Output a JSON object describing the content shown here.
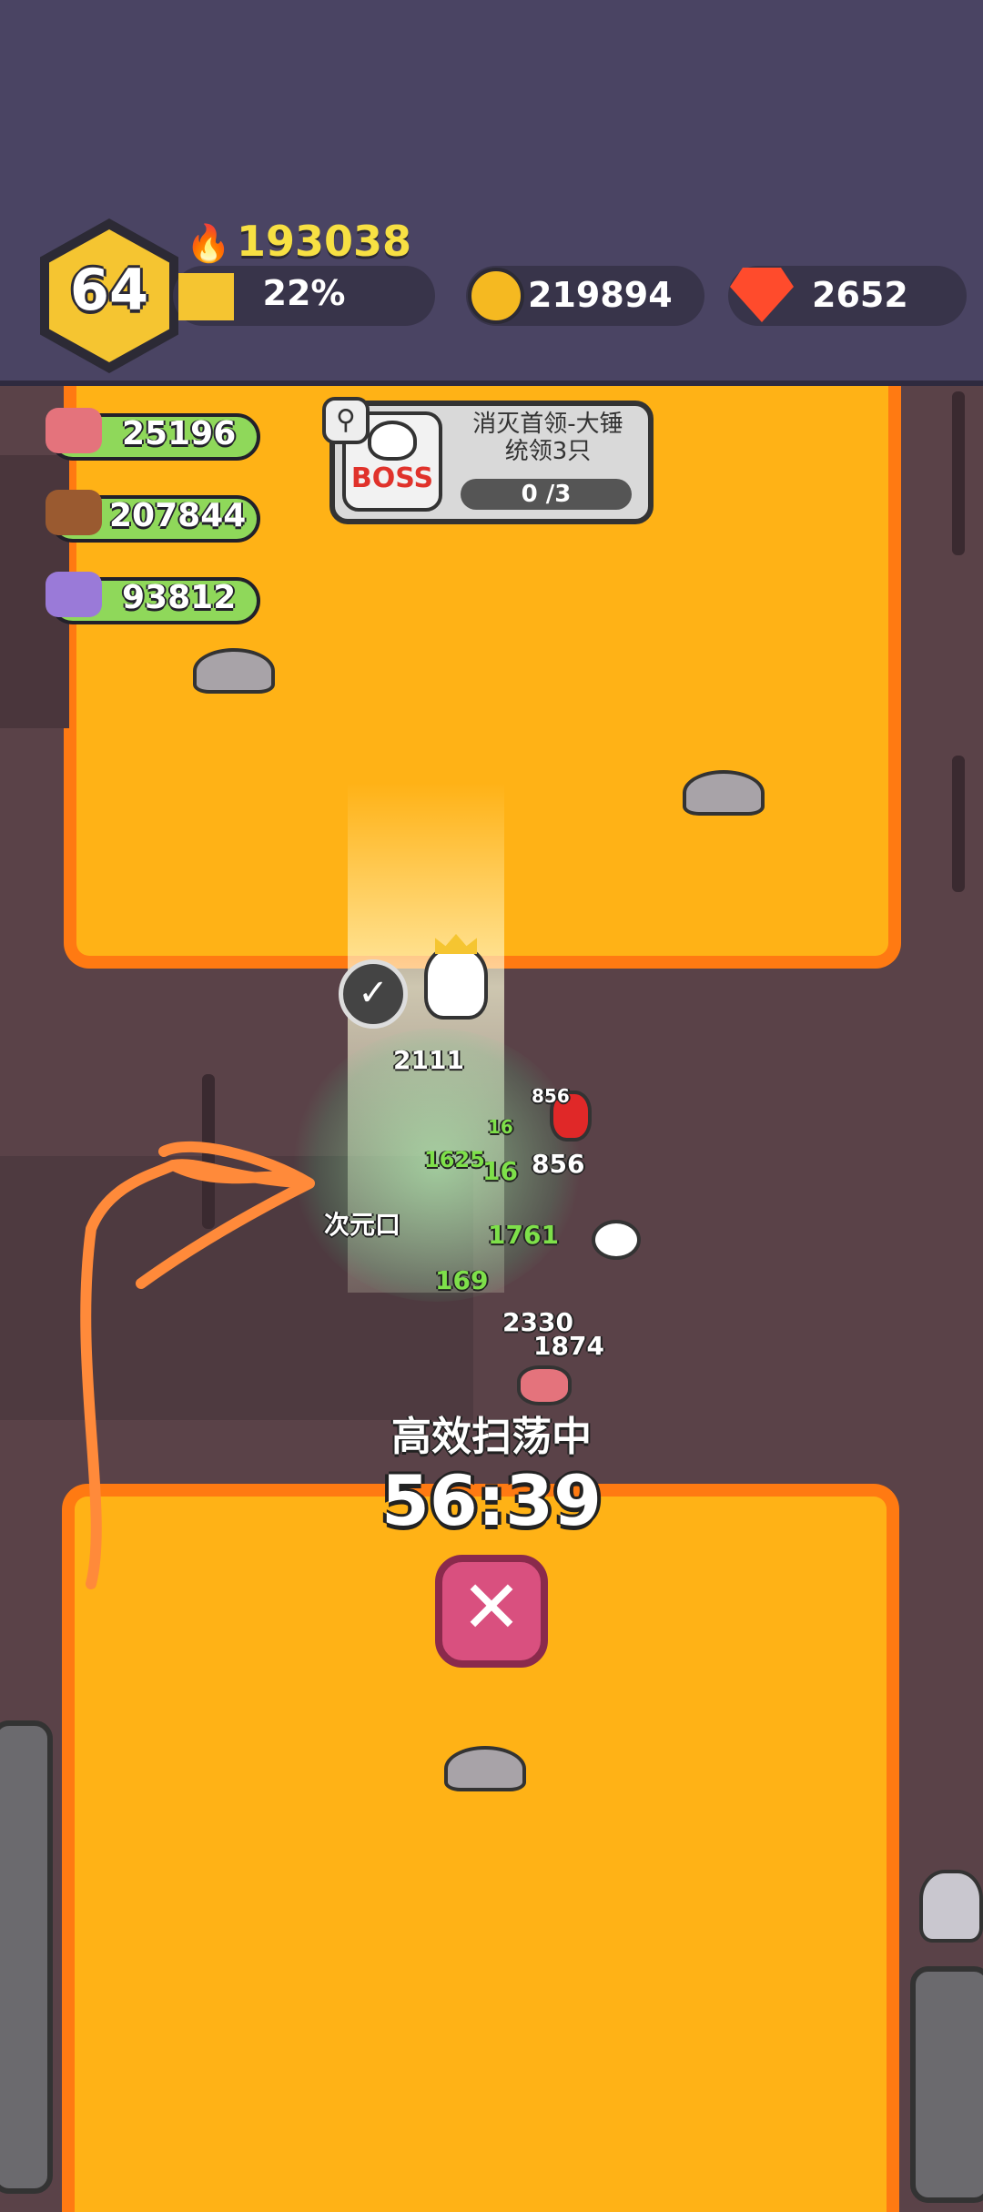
{
  "player": {
    "level": "64",
    "power": "193038",
    "xp_percent_label": "22%",
    "xp_fraction": 0.22
  },
  "currencies": {
    "gold": "219894",
    "gems": "2652"
  },
  "resources": [
    {
      "icon": "meat-icon",
      "value": "25196"
    },
    {
      "icon": "wood-icon",
      "value": "207844"
    },
    {
      "icon": "ore-icon",
      "value": "93812"
    }
  ],
  "quest": {
    "badge": "BOSS",
    "title_line1": "消灭首领-大锤",
    "title_line2": "统领3只",
    "progress": "0 /3"
  },
  "battle": {
    "damage_numbers": [
      "2111",
      "856",
      "856",
      "16",
      "16",
      "1625",
      "1761",
      "169",
      "2330",
      "1874"
    ],
    "partial_label": "次元口"
  },
  "sweep": {
    "status": "高效扫荡中",
    "timer": "56:39"
  },
  "colors": {
    "sand": "#ffb216",
    "sand_border": "#ff7a12",
    "ground": "#5a4248",
    "topbar": "#4a4463",
    "accent_gold": "#f5c531",
    "close_button": "#d9507f"
  }
}
